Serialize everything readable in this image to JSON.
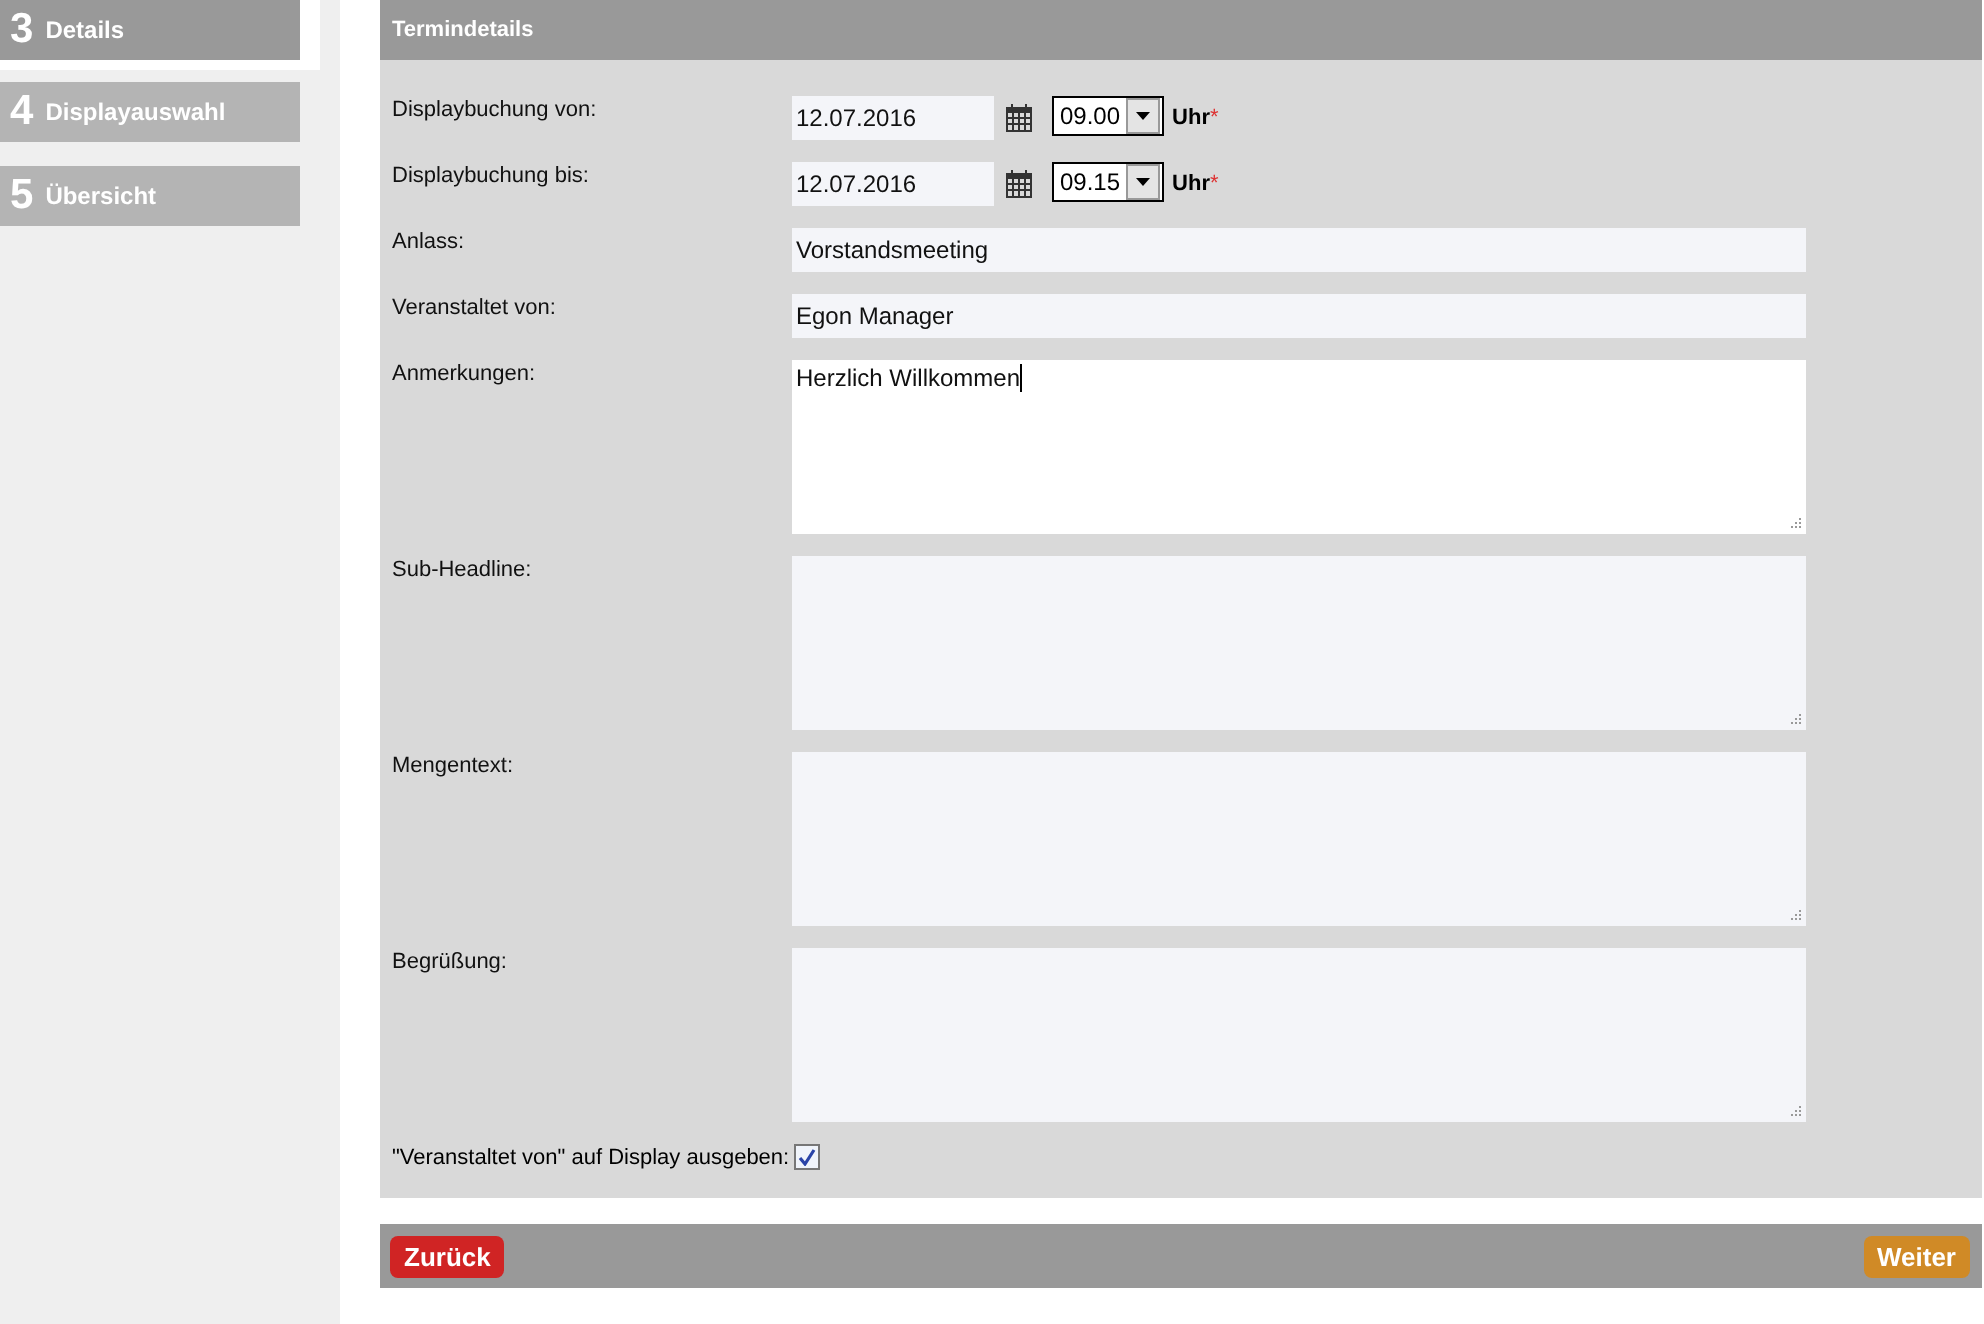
{
  "steps": [
    {
      "number": "3",
      "label": "Details",
      "selected": true
    },
    {
      "number": "4",
      "label": "Displayauswahl",
      "selected": false
    },
    {
      "number": "5",
      "label": "Übersicht",
      "selected": false
    }
  ],
  "panel": {
    "title": "Termindetails"
  },
  "fields": [
    {
      "kind": "datetime",
      "label": "Displaybuchung von:",
      "date": "12.07.2016",
      "time": "09.00",
      "unit": "Uhr",
      "required": "*"
    },
    {
      "kind": "datetime",
      "label": "Displaybuchung bis:",
      "date": "12.07.2016",
      "time": "09.15",
      "unit": "Uhr",
      "required": "*"
    },
    {
      "kind": "text",
      "label": "Anlass:",
      "value": "Vorstandsmeeting"
    },
    {
      "kind": "text",
      "label": "Veranstaltet von:",
      "value": "Egon Manager"
    },
    {
      "kind": "textarea",
      "label": "Anmerkungen:",
      "value": "Herzlich Willkommen",
      "focused": true
    },
    {
      "kind": "textarea",
      "label": "Sub-Headline:",
      "focused": false
    },
    {
      "kind": "textarea",
      "label": "Mengentext:",
      "focused": false
    },
    {
      "kind": "textarea",
      "label": "Begrüßung:",
      "focused": false
    }
  ],
  "display_option": {
    "label": "\"Veranstaltet von\" auf Display ausgeben:",
    "checked": true
  },
  "buttons": [
    {
      "kind": "back",
      "label": "Zurück"
    },
    {
      "kind": "next",
      "label": "Weiter"
    }
  ]
}
